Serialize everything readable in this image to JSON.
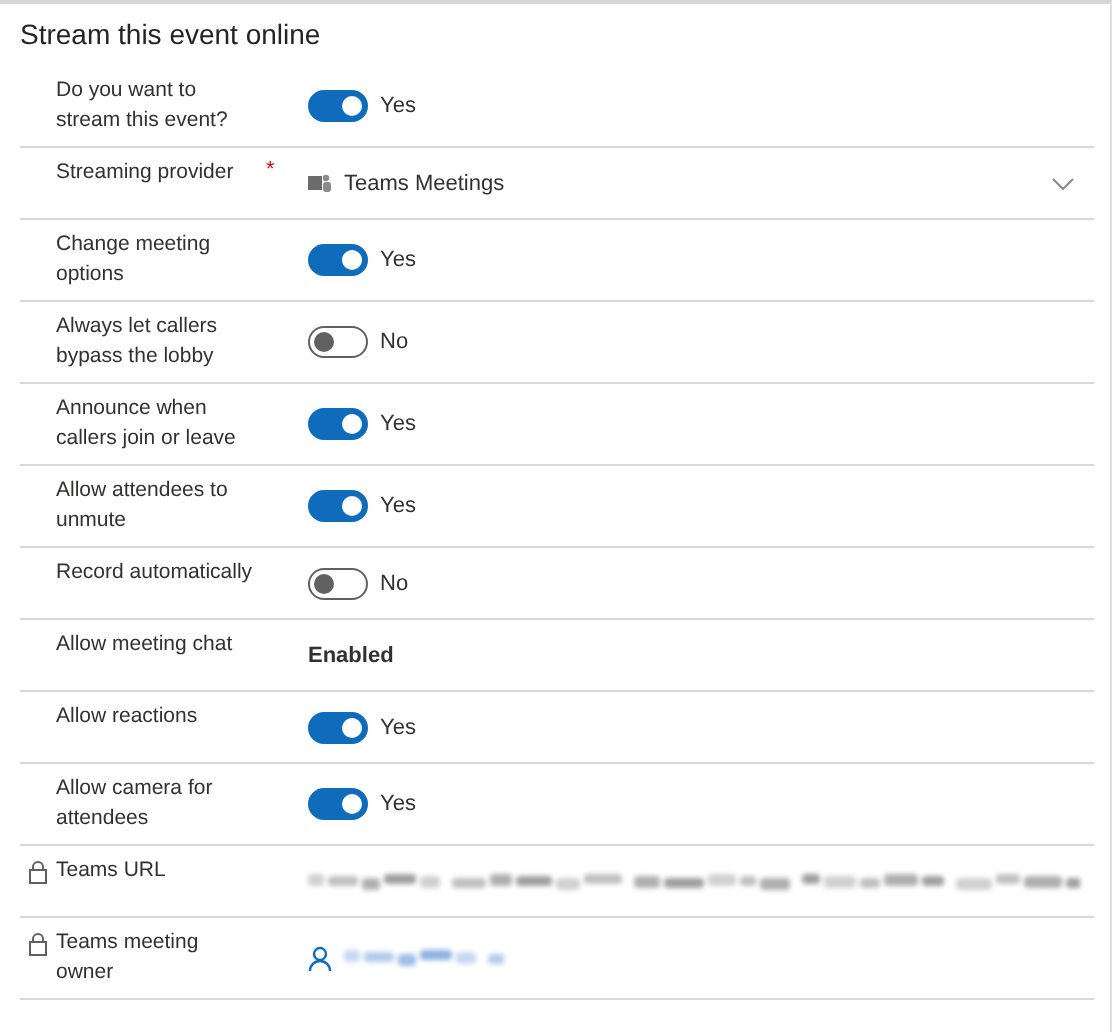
{
  "section": {
    "title": "Stream this event online"
  },
  "rows": [
    {
      "label": "Do you want to stream this event?",
      "kind": "toggle",
      "on": true,
      "value": "Yes"
    },
    {
      "label": "Streaming provider",
      "required_mark": "*",
      "kind": "select",
      "value": "Teams Meetings"
    },
    {
      "label": "Change meeting options",
      "kind": "toggle",
      "on": true,
      "value": "Yes"
    },
    {
      "label": "Always let callers bypass the lobby",
      "kind": "toggle",
      "on": false,
      "value": "No"
    },
    {
      "label": "Announce when callers join or leave",
      "kind": "toggle",
      "on": true,
      "value": "Yes"
    },
    {
      "label": "Allow attendees to unmute",
      "kind": "toggle",
      "on": true,
      "value": "Yes"
    },
    {
      "label": "Record automatically",
      "kind": "toggle",
      "on": false,
      "value": "No"
    },
    {
      "label": "Allow meeting chat",
      "kind": "text",
      "value": "Enabled"
    },
    {
      "label": "Allow reactions",
      "kind": "toggle",
      "on": true,
      "value": "Yes"
    },
    {
      "label": "Allow camera for attendees",
      "kind": "toggle",
      "on": true,
      "value": "Yes"
    },
    {
      "label": "Teams URL",
      "locked": true,
      "kind": "blurred"
    },
    {
      "label": "Teams meeting owner",
      "locked": true,
      "kind": "blurred-person"
    }
  ]
}
